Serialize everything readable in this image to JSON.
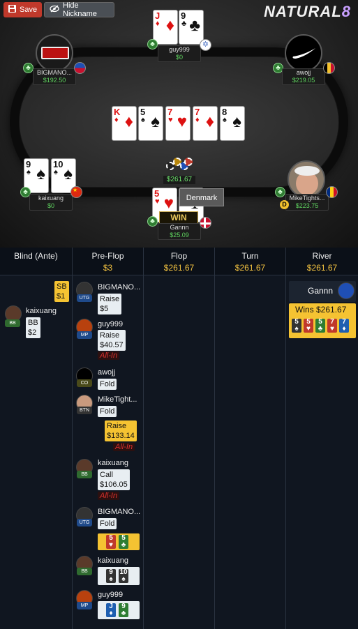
{
  "toolbar": {
    "save_label": "Save",
    "hide_nickname_label": "Hide Nickname"
  },
  "brand": {
    "name": "NATURAL",
    "suffix": "8"
  },
  "pot": "$261.67",
  "tooltip": "Denmark",
  "win_label": "WIN",
  "board": [
    {
      "rank": "K",
      "suit": "♦",
      "color": "red"
    },
    {
      "rank": "5",
      "suit": "♠",
      "color": "blk"
    },
    {
      "rank": "7",
      "suit": "♥",
      "color": "red"
    },
    {
      "rank": "7",
      "suit": "♦",
      "color": "red"
    },
    {
      "rank": "8",
      "suit": "♠",
      "color": "blk"
    }
  ],
  "players": {
    "guy999": {
      "name": "guy999",
      "stack": "$0",
      "cards": [
        {
          "rank": "J",
          "suit": "♦",
          "color": "red"
        },
        {
          "rank": "9",
          "suit": "♣",
          "color": "blk"
        }
      ]
    },
    "bigmano": {
      "name": "BIGMANO...",
      "stack": "$192.50"
    },
    "awojj": {
      "name": "awojj",
      "stack": "$219.05"
    },
    "kaixuang": {
      "name": "kaixuang",
      "stack": "$0",
      "cards": [
        {
          "rank": "9",
          "suit": "♠",
          "color": "blk"
        },
        {
          "rank": "10",
          "suit": "♠",
          "color": "blk"
        }
      ]
    },
    "mike": {
      "name": "MikeTights...",
      "stack": "$223.75"
    },
    "gannn": {
      "name": "Gannn",
      "stack": "$25.09",
      "cards": [
        {
          "rank": "5",
          "suit": "♥",
          "color": "red"
        },
        {
          "rank": "5",
          "suit": "♣",
          "color": "blk"
        }
      ]
    }
  },
  "history": {
    "columns": [
      {
        "title": "Blind (Ante)",
        "value": ""
      },
      {
        "title": "Pre-Flop",
        "value": "$3"
      },
      {
        "title": "Flop",
        "value": "$261.67"
      },
      {
        "title": "Turn",
        "value": "$261.67"
      },
      {
        "title": "River",
        "value": "$261.67"
      }
    ],
    "blind": {
      "sb_label": "SB",
      "sb_amount": "$1",
      "bb_player": "kaixuang",
      "bb_pos": "BB",
      "bb_label": "BB",
      "bb_amount": "$2"
    },
    "preflop": [
      {
        "name": "BIGMANO...",
        "pos": "UTG",
        "action": "Raise",
        "amount": "$5"
      },
      {
        "name": "guy999",
        "pos": "MP",
        "action": "Raise",
        "amount": "$40.57",
        "allin": "All-In"
      },
      {
        "name": "awojj",
        "pos": "CO",
        "action": "Fold"
      },
      {
        "name": "MikeTight...",
        "pos": "BTN",
        "action": "Fold"
      },
      {
        "action": "Raise",
        "amount": "$133.14",
        "allin": "All-In"
      },
      {
        "name": "kaixuang",
        "pos": "BB",
        "action": "Call",
        "amount": "$106.05",
        "allin": "All-In"
      },
      {
        "name": "BIGMANO...",
        "pos": "UTG",
        "action": "Fold"
      }
    ],
    "showdown": [
      {
        "cards": [
          {
            "rank": "5",
            "suit": "♥",
            "bg": "#c0392b"
          },
          {
            "rank": "5",
            "suit": "♣",
            "bg": "#2e7d32"
          }
        ]
      },
      {
        "name": "kaixuang",
        "pos": "BB",
        "cards": [
          {
            "rank": "9",
            "suit": "♠",
            "bg": "#333"
          },
          {
            "rank": "10",
            "suit": "♠",
            "bg": "#333"
          }
        ]
      },
      {
        "name": "guy999",
        "pos": "MP",
        "cards": [
          {
            "rank": "J",
            "suit": "♦",
            "bg": "#1f5fb0"
          },
          {
            "rank": "9",
            "suit": "♣",
            "bg": "#2e7d32"
          }
        ]
      }
    ],
    "river": {
      "winner": "Gannn",
      "wins_label": "Wins $261.67",
      "cards": [
        {
          "rank": "5",
          "suit": "♠",
          "bg": "#333"
        },
        {
          "rank": "5",
          "suit": "♥",
          "bg": "#c0392b"
        },
        {
          "rank": "5",
          "suit": "♣",
          "bg": "#2e7d32"
        },
        {
          "rank": "7",
          "suit": "♥",
          "bg": "#c0392b"
        },
        {
          "rank": "7",
          "suit": "♦",
          "bg": "#1f5fb0"
        }
      ]
    }
  }
}
